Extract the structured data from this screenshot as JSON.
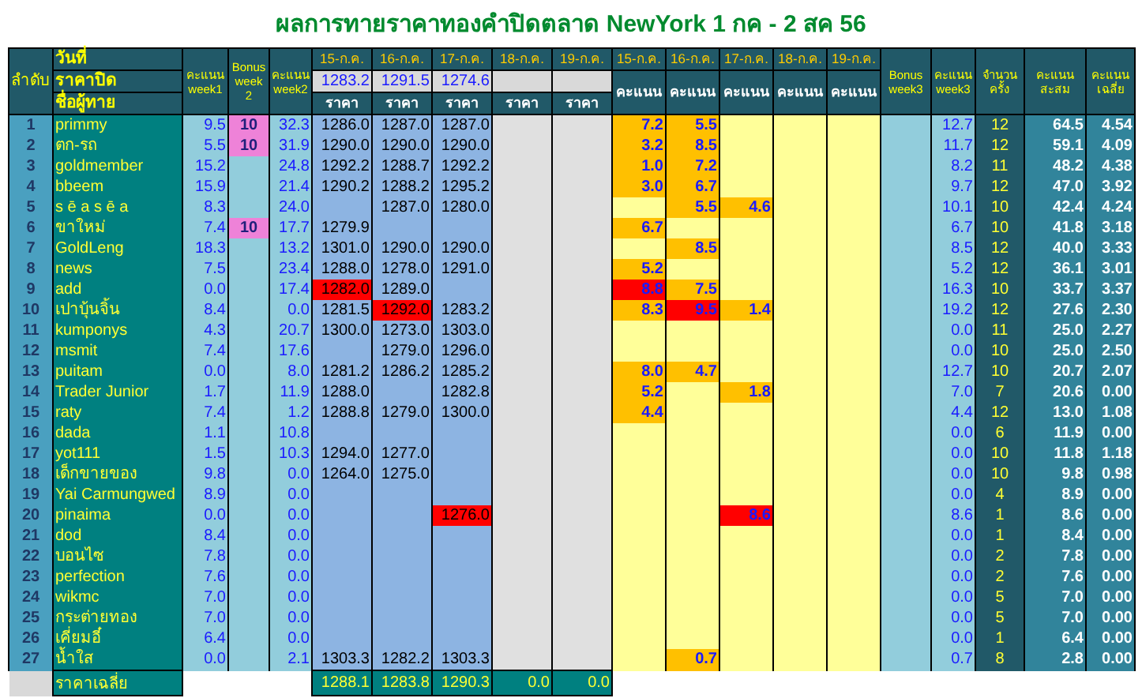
{
  "title": "ผลการทายราคาทองคำปิดตลาด NewYork 1 กค - 2 สค 56",
  "header": {
    "rank": "ลำดับ",
    "date_label": "วันที่",
    "close_label": "ราคาปิด",
    "name_label": "ชื่อผู้ทาย",
    "week1": "คะแนน week1",
    "bonus2": "Bonus week 2",
    "week2": "คะแนน week2",
    "days": [
      {
        "date": "15-ก.ค.",
        "close": "1283.2",
        "price_label": "ราคา"
      },
      {
        "date": "16-ก.ค.",
        "close": "1291.5",
        "price_label": "ราคา"
      },
      {
        "date": "17-ก.ค.",
        "close": "1274.6",
        "price_label": "ราคา"
      },
      {
        "date": "18-ก.ค.",
        "price_label": "ราคา"
      },
      {
        "date": "19-ก.ค.",
        "price_label": "ราคา"
      }
    ],
    "score_days": [
      {
        "date": "15-ก.ค.",
        "label": "คะแนน"
      },
      {
        "date": "16-ก.ค.",
        "label": "คะแนน"
      },
      {
        "date": "17-ก.ค.",
        "label": "คะแนน"
      },
      {
        "date": "18-ก.ค.",
        "label": "คะแนน"
      },
      {
        "date": "19-ก.ค.",
        "label": "คะแนน"
      }
    ],
    "bonus3": "Bonus week3",
    "week3": "คะแนน week3",
    "count": "จำนวน ครั้ง",
    "total": "คะแนน สะสม",
    "average": "คะแนน เฉลี่ย"
  },
  "rows": [
    {
      "rank": "1",
      "name": "primmy",
      "week1": "9.5",
      "bonus2": "10",
      "week2": "32.3",
      "days": [
        {
          "price": "1286.0",
          "score": "7.2",
          "best": false
        },
        {
          "price": "1287.0",
          "score": "5.5",
          "best": false
        },
        {
          "price": "1287.0",
          "best": false
        },
        {
          "best": false
        },
        {
          "best": false
        }
      ],
      "week3": "12.7",
      "count": "12",
      "total": "64.5",
      "average": "4.54"
    },
    {
      "rank": "2",
      "name": "ตก-รถ",
      "week1": "5.5",
      "bonus2": "10",
      "week2": "31.9",
      "days": [
        {
          "price": "1290.0",
          "score": "3.2",
          "best": false
        },
        {
          "price": "1290.0",
          "score": "8.5",
          "best": false
        },
        {
          "price": "1290.0",
          "best": false
        },
        {
          "best": false
        },
        {
          "best": false
        }
      ],
      "week3": "11.7",
      "count": "12",
      "total": "59.1",
      "average": "4.09"
    },
    {
      "rank": "3",
      "name": "goldmember",
      "week1": "15.2",
      "week2": "24.8",
      "days": [
        {
          "price": "1292.2",
          "score": "1.0",
          "best": false
        },
        {
          "price": "1288.7",
          "score": "7.2",
          "best": false
        },
        {
          "price": "1292.2",
          "best": false
        },
        {
          "best": false
        },
        {
          "best": false
        }
      ],
      "week3": "8.2",
      "count": "11",
      "total": "48.2",
      "average": "4.38"
    },
    {
      "rank": "4",
      "name": "bbeem",
      "week1": "15.9",
      "week2": "21.4",
      "days": [
        {
          "price": "1290.2",
          "score": "3.0",
          "best": false
        },
        {
          "price": "1288.2",
          "score": "6.7",
          "best": false
        },
        {
          "price": "1295.2",
          "best": false
        },
        {
          "best": false
        },
        {
          "best": false
        }
      ],
      "week3": "9.7",
      "count": "12",
      "total": "47.0",
      "average": "3.92"
    },
    {
      "rank": "5",
      "name": "s ē a s ē a",
      "week1": "8.3",
      "week2": "24.0",
      "days": [
        {
          "best": false
        },
        {
          "price": "1287.0",
          "score": "5.5",
          "best": false
        },
        {
          "price": "1280.0",
          "score": "4.6",
          "best": false
        },
        {
          "best": false
        },
        {
          "best": false
        }
      ],
      "week3": "10.1",
      "count": "10",
      "total": "42.4",
      "average": "4.24"
    },
    {
      "rank": "6",
      "name": "ขาใหม่",
      "week1": "7.4",
      "bonus2": "10",
      "week2": "17.7",
      "days": [
        {
          "price": "1279.9",
          "score": "6.7",
          "best": false
        },
        {
          "best": false
        },
        {
          "best": false
        },
        {
          "best": false
        },
        {
          "best": false
        }
      ],
      "week3": "6.7",
      "count": "10",
      "total": "41.8",
      "average": "3.18"
    },
    {
      "rank": "7",
      "name": "GoldLeng",
      "week1": "18.3",
      "week2": "13.2",
      "days": [
        {
          "price": "1301.0",
          "best": false
        },
        {
          "price": "1290.0",
          "score": "8.5",
          "best": false
        },
        {
          "price": "1290.0",
          "best": false
        },
        {
          "best": false
        },
        {
          "best": false
        }
      ],
      "week3": "8.5",
      "count": "12",
      "total": "40.0",
      "average": "3.33"
    },
    {
      "rank": "8",
      "name": "news",
      "week1": "7.5",
      "week2": "23.4",
      "days": [
        {
          "price": "1288.0",
          "score": "5.2",
          "best": false
        },
        {
          "price": "1278.0",
          "best": false
        },
        {
          "price": "1291.0",
          "best": false
        },
        {
          "best": false
        },
        {
          "best": false
        }
      ],
      "week3": "5.2",
      "count": "12",
      "total": "36.1",
      "average": "3.01"
    },
    {
      "rank": "9",
      "name": "add",
      "week1": "0.0",
      "week2": "17.4",
      "days": [
        {
          "price": "1282.0",
          "score": "8.8",
          "best": true
        },
        {
          "price": "1289.0",
          "score": "7.5",
          "best": false
        },
        {
          "best": false
        },
        {
          "best": false
        },
        {
          "best": false
        }
      ],
      "week3": "16.3",
      "count": "10",
      "total": "33.7",
      "average": "3.37"
    },
    {
      "rank": "10",
      "name": "เปาบุ้นจิ้น",
      "week1": "8.4",
      "week2": "0.0",
      "days": [
        {
          "price": "1281.5",
          "score": "8.3",
          "best": false
        },
        {
          "price": "1292.0",
          "score": "9.5",
          "best": true
        },
        {
          "price": "1283.2",
          "score": "1.4",
          "best": false
        },
        {
          "best": false
        },
        {
          "best": false
        }
      ],
      "week3": "19.2",
      "count": "12",
      "total": "27.6",
      "average": "2.30"
    },
    {
      "rank": "11",
      "name": "kumponys",
      "week1": "4.3",
      "week2": "20.7",
      "days": [
        {
          "price": "1300.0",
          "best": false
        },
        {
          "price": "1273.0",
          "best": false
        },
        {
          "price": "1303.0",
          "best": false
        },
        {
          "best": false
        },
        {
          "best": false
        }
      ],
      "week3": "0.0",
      "count": "11",
      "total": "25.0",
      "average": "2.27"
    },
    {
      "rank": "12",
      "name": "msmit",
      "week1": "7.4",
      "week2": "17.6",
      "days": [
        {
          "best": false
        },
        {
          "price": "1279.0",
          "best": false
        },
        {
          "price": "1296.0",
          "best": false
        },
        {
          "best": false
        },
        {
          "best": false
        }
      ],
      "week3": "0.0",
      "count": "10",
      "total": "25.0",
      "average": "2.50"
    },
    {
      "rank": "13",
      "name": "puitam",
      "week1": "0.0",
      "week2": "8.0",
      "days": [
        {
          "price": "1281.2",
          "score": "8.0",
          "best": false
        },
        {
          "price": "1286.2",
          "score": "4.7",
          "best": false
        },
        {
          "price": "1285.2",
          "best": false
        },
        {
          "best": false
        },
        {
          "best": false
        }
      ],
      "week3": "12.7",
      "count": "10",
      "total": "20.7",
      "average": "2.07"
    },
    {
      "rank": "14",
      "name": "Trader Junior",
      "week1": "1.7",
      "week2": "11.9",
      "days": [
        {
          "price": "1288.0",
          "score": "5.2",
          "best": false
        },
        {
          "best": false
        },
        {
          "price": "1282.8",
          "score": "1.8",
          "best": false
        },
        {
          "best": false
        },
        {
          "best": false
        }
      ],
      "week3": "7.0",
      "count": "7",
      "total": "20.6",
      "average": "0.00"
    },
    {
      "rank": "15",
      "name": "raty",
      "week1": "7.4",
      "week2": "1.2",
      "days": [
        {
          "price": "1288.8",
          "score": "4.4",
          "best": false
        },
        {
          "price": "1279.0",
          "best": false
        },
        {
          "price": "1300.0",
          "best": false
        },
        {
          "best": false
        },
        {
          "best": false
        }
      ],
      "week3": "4.4",
      "count": "12",
      "total": "13.0",
      "average": "1.08"
    },
    {
      "rank": "16",
      "name": "dada",
      "week1": "1.1",
      "week2": "10.8",
      "days": [
        {
          "best": false
        },
        {
          "best": false
        },
        {
          "best": false
        },
        {
          "best": false
        },
        {
          "best": false
        }
      ],
      "week3": "0.0",
      "count": "6",
      "total": "11.9",
      "average": "0.00"
    },
    {
      "rank": "17",
      "name": "yot111",
      "week1": "1.5",
      "week2": "10.3",
      "days": [
        {
          "price": "1294.0",
          "best": false
        },
        {
          "price": "1277.0",
          "best": false
        },
        {
          "best": false
        },
        {
          "best": false
        },
        {
          "best": false
        }
      ],
      "week3": "0.0",
      "count": "10",
      "total": "11.8",
      "average": "1.18"
    },
    {
      "rank": "18",
      "name": "เด็กขายของ",
      "week1": "9.8",
      "week2": "0.0",
      "days": [
        {
          "price": "1264.0",
          "best": false
        },
        {
          "price": "1275.0",
          "best": false
        },
        {
          "best": false
        },
        {
          "best": false
        },
        {
          "best": false
        }
      ],
      "week3": "0.0",
      "count": "10",
      "total": "9.8",
      "average": "0.98"
    },
    {
      "rank": "19",
      "name": "Yai Carmungwed",
      "week1": "8.9",
      "week2": "0.0",
      "days": [
        {
          "best": false
        },
        {
          "best": false
        },
        {
          "best": false
        },
        {
          "best": false
        },
        {
          "best": false
        }
      ],
      "week3": "0.0",
      "count": "4",
      "total": "8.9",
      "average": "0.00"
    },
    {
      "rank": "20",
      "name": "pinaima",
      "week1": "0.0",
      "week2": "0.0",
      "days": [
        {
          "best": false
        },
        {
          "best": false
        },
        {
          "price": "1276.0",
          "score": "8.6",
          "best": true
        },
        {
          "best": false
        },
        {
          "best": false
        }
      ],
      "week3": "8.6",
      "count": "1",
      "total": "8.6",
      "average": "0.00"
    },
    {
      "rank": "21",
      "name": "dod",
      "week1": "8.4",
      "week2": "0.0",
      "days": [
        {
          "best": false
        },
        {
          "best": false
        },
        {
          "best": false
        },
        {
          "best": false
        },
        {
          "best": false
        }
      ],
      "week3": "0.0",
      "count": "1",
      "total": "8.4",
      "average": "0.00"
    },
    {
      "rank": "22",
      "name": "บอนไซ",
      "week1": "7.8",
      "week2": "0.0",
      "days": [
        {
          "best": false
        },
        {
          "best": false
        },
        {
          "best": false
        },
        {
          "best": false
        },
        {
          "best": false
        }
      ],
      "week3": "0.0",
      "count": "2",
      "total": "7.8",
      "average": "0.00"
    },
    {
      "rank": "23",
      "name": "perfection",
      "week1": "7.6",
      "week2": "0.0",
      "days": [
        {
          "best": false
        },
        {
          "best": false
        },
        {
          "best": false
        },
        {
          "best": false
        },
        {
          "best": false
        }
      ],
      "week3": "0.0",
      "count": "2",
      "total": "7.6",
      "average": "0.00"
    },
    {
      "rank": "24",
      "name": "wikmc",
      "week1": "7.0",
      "week2": "0.0",
      "days": [
        {
          "best": false
        },
        {
          "best": false
        },
        {
          "best": false
        },
        {
          "best": false
        },
        {
          "best": false
        }
      ],
      "week3": "0.0",
      "count": "5",
      "total": "7.0",
      "average": "0.00"
    },
    {
      "rank": "25",
      "name": "กระต่ายทอง",
      "week1": "7.0",
      "week2": "0.0",
      "days": [
        {
          "best": false
        },
        {
          "best": false
        },
        {
          "best": false
        },
        {
          "best": false
        },
        {
          "best": false
        }
      ],
      "week3": "0.0",
      "count": "5",
      "total": "7.0",
      "average": "0.00"
    },
    {
      "rank": "26",
      "name": "เคี่ยมอี๋",
      "week1": "6.4",
      "week2": "0.0",
      "days": [
        {
          "best": false
        },
        {
          "best": false
        },
        {
          "best": false
        },
        {
          "best": false
        },
        {
          "best": false
        }
      ],
      "week3": "0.0",
      "count": "1",
      "total": "6.4",
      "average": "0.00"
    },
    {
      "rank": "27",
      "name": "น้ำใส",
      "week1": "0.0",
      "week2": "2.1",
      "days": [
        {
          "price": "1303.3",
          "best": false
        },
        {
          "price": "1282.2",
          "score": "0.7",
          "best": false
        },
        {
          "price": "1303.3",
          "best": false
        },
        {
          "best": false
        },
        {
          "best": false
        }
      ],
      "week3": "0.7",
      "count": "8",
      "total": "2.8",
      "average": "0.00"
    }
  ],
  "footer": {
    "label": "ราคาเฉลี่ย",
    "averages": [
      "1288.1",
      "1283.8",
      "1290.3",
      "0.0",
      "0.0"
    ]
  }
}
